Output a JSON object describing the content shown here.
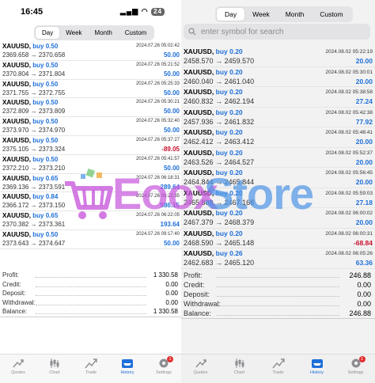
{
  "left": {
    "status": {
      "time": "16:45",
      "battery": "24"
    },
    "periods": [
      "Day",
      "Week",
      "Month",
      "Custom"
    ],
    "active_period": "Day",
    "trades": [
      {
        "symbol": "XAUUSD,",
        "side": "buy 0.50",
        "open": "2369.658",
        "close": "2370.658",
        "date": "2024.07.26 05:02:42",
        "profit": "50.00",
        "dir": "pos"
      },
      {
        "symbol": "XAUUSD,",
        "side": "buy 0.50",
        "open": "2370.804",
        "close": "2371.804",
        "date": "2024.07.26 05:21:52",
        "profit": "50.00",
        "dir": "pos"
      },
      {
        "symbol": "XAUUSD,",
        "side": "buy 0.50",
        "open": "2371.755",
        "close": "2372.755",
        "date": "2024.07.26 05:25:33",
        "profit": "50.00",
        "dir": "pos"
      },
      {
        "symbol": "XAUUSD,",
        "side": "buy 0.50",
        "open": "2372.809",
        "close": "2373.809",
        "date": "2024.07.26 05:30:21",
        "profit": "50.00",
        "dir": "pos"
      },
      {
        "symbol": "XAUUSD,",
        "side": "buy 0.50",
        "open": "2373.970",
        "close": "2374.970",
        "date": "2024.07.26 05:32:40",
        "profit": "50.00",
        "dir": "pos"
      },
      {
        "symbol": "XAUUSD,",
        "side": "buy 0.50",
        "open": "2375.105",
        "close": "2373.324",
        "date": "2024.07.26 05:37:27",
        "profit": "-89.05",
        "dir": "neg"
      },
      {
        "symbol": "XAUUSD,",
        "side": "buy 0.50",
        "open": "2372.210",
        "close": "2373.210",
        "date": "2024.07.26 05:41:57",
        "profit": "50.00",
        "dir": "pos"
      },
      {
        "symbol": "XAUUSD,",
        "side": "buy 0.65",
        "open": "2369.136",
        "close": "2373.591",
        "date": "2024.07.26 06:18:31",
        "profit": "289.64",
        "dir": "pos"
      },
      {
        "symbol": "XAUUSD,",
        "side": "buy 0.84",
        "open": "2366.172",
        "close": "2373.150",
        "date": "2024.07.26 06:21:35",
        "profit": "586.15",
        "dir": "pos"
      },
      {
        "symbol": "XAUUSD,",
        "side": "buy 0.65",
        "open": "2370.382",
        "close": "2373.361",
        "date": "2024.07.26 06:22:05",
        "profit": "193.64",
        "dir": "pos"
      },
      {
        "symbol": "XAUUSD,",
        "side": "buy 0.50",
        "open": "2373.643",
        "close": "2374.647",
        "date": "2024.07.26 09:17:40",
        "profit": "50.00",
        "dir": "pos"
      }
    ],
    "summary": [
      {
        "label": "Profit:",
        "value": "1 330.58"
      },
      {
        "label": "Credit:",
        "value": "0.00"
      },
      {
        "label": "Deposit:",
        "value": "0.00"
      },
      {
        "label": "Withdrawal:",
        "value": "0.00"
      },
      {
        "label": "Balance:",
        "value": "1 330.58"
      }
    ],
    "tabs": [
      "Quotes",
      "Chart",
      "Trade",
      "History",
      "Settings"
    ],
    "active_tab": "History",
    "settings_badge": "1"
  },
  "right": {
    "periods": [
      "Day",
      "Week",
      "Month",
      "Custom"
    ],
    "active_period": "Day",
    "search_placeholder": "enter symbol for search",
    "trades": [
      {
        "symbol": "XAUUSD,",
        "side": "buy 0.20",
        "open": "2458.570",
        "close": "2459.570",
        "date": "2024.08.02 05:22:19",
        "profit": "20.00",
        "dir": "pos"
      },
      {
        "symbol": "XAUUSD,",
        "side": "buy 0.20",
        "open": "2460.040",
        "close": "2461.040",
        "date": "2024.08.02 05:30:01",
        "profit": "20.00",
        "dir": "pos"
      },
      {
        "symbol": "XAUUSD,",
        "side": "buy 0.20",
        "open": "2460.832",
        "close": "2462.194",
        "date": "2024.08.02 05:38:58",
        "profit": "27.24",
        "dir": "pos"
      },
      {
        "symbol": "XAUUSD,",
        "side": "buy 0.20",
        "open": "2457.936",
        "close": "2461.832",
        "date": "2024.08.02 05:42:38",
        "profit": "77.92",
        "dir": "pos"
      },
      {
        "symbol": "XAUUSD,",
        "side": "buy 0.20",
        "open": "2462.412",
        "close": "2463.412",
        "date": "2024.08.02 05:48:41",
        "profit": "20.00",
        "dir": "pos"
      },
      {
        "symbol": "XAUUSD,",
        "side": "buy 0.20",
        "open": "2463.526",
        "close": "2464.527",
        "date": "2024.08.02 05:52:37",
        "profit": "20.00",
        "dir": "pos"
      },
      {
        "symbol": "XAUUSD,",
        "side": "buy 0.20",
        "open": "2464.844",
        "close": "2465.844",
        "date": "2024.08.02 05:56:45",
        "profit": "20.00",
        "dir": "pos"
      },
      {
        "symbol": "XAUUSD,",
        "side": "buy 0.20",
        "open": "2465.809",
        "close": "2467.168",
        "date": "2024.08.02 05:59:03",
        "profit": "27.18",
        "dir": "pos"
      },
      {
        "symbol": "XAUUSD,",
        "side": "buy 0.20",
        "open": "2467.379",
        "close": "2468.379",
        "date": "2024.08.02 06:00:02",
        "profit": "20.00",
        "dir": "pos"
      },
      {
        "symbol": "XAUUSD,",
        "side": "buy 0.20",
        "open": "2468.590",
        "close": "2465.148",
        "date": "2024.08.02 06:00:31",
        "profit": "-68.84",
        "dir": "neg"
      },
      {
        "symbol": "XAUUSD,",
        "side": "buy 0.26",
        "open": "2462.683",
        "close": "2465.120",
        "date": "2024.08.02 06:05:26",
        "profit": "63.36",
        "dir": "pos"
      }
    ],
    "summary": [
      {
        "label": "Profit:",
        "value": "246.88"
      },
      {
        "label": "Credit:",
        "value": "0.00"
      },
      {
        "label": "Deposit:",
        "value": "0.00"
      },
      {
        "label": "Withdrawal:",
        "value": "0.00"
      },
      {
        "label": "Balance:",
        "value": "246.88"
      }
    ],
    "tabs": [
      "Quotes",
      "Chart",
      "Trade",
      "History",
      "Settings"
    ],
    "active_tab": "History",
    "settings_badge": "1"
  },
  "watermark": {
    "part1": "Eoox",
    "part2": "Store"
  },
  "colors": {
    "buy": "#1e6fd9",
    "loss": "#c8102e",
    "accent": "#1e6fd9"
  },
  "arrow": "→"
}
